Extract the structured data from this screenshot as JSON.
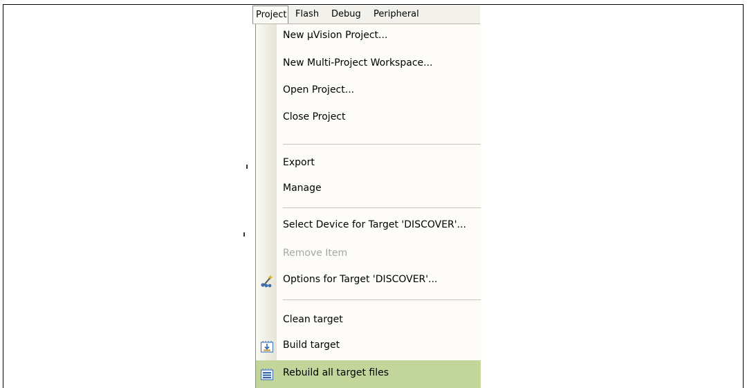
{
  "menubar": {
    "items": [
      "Project",
      "Flash",
      "Debug",
      "Peripheral"
    ]
  },
  "menu": {
    "items": [
      {
        "label": "New µVision Project...",
        "name": "menu-item-new-uvision-project",
        "disabled": false
      },
      {
        "label": "New Multi-Project Workspace...",
        "name": "menu-item-new-multi-project-workspace",
        "disabled": false
      },
      {
        "label": "Open Project...",
        "name": "menu-item-open-project",
        "disabled": false
      },
      {
        "label": "Close Project",
        "name": "menu-item-close-project",
        "disabled": false
      },
      {
        "label": "Export",
        "name": "menu-item-export",
        "disabled": false
      },
      {
        "label": "Manage",
        "name": "menu-item-manage",
        "disabled": false
      },
      {
        "label": "Select Device for Target 'DISCOVER'...",
        "name": "menu-item-select-device",
        "disabled": false
      },
      {
        "label": "Remove Item",
        "name": "menu-item-remove-item",
        "disabled": true
      },
      {
        "label": "Options for Target 'DISCOVER'...",
        "name": "menu-item-options-for-target",
        "disabled": false,
        "icon": "options-wand-icon"
      },
      {
        "label": "Clean target",
        "name": "menu-item-clean-target",
        "disabled": false
      },
      {
        "label": "Build target",
        "name": "menu-item-build-target",
        "disabled": false,
        "icon": "build-icon"
      },
      {
        "label": "Rebuild all target files",
        "name": "menu-item-rebuild-all",
        "disabled": false,
        "icon": "rebuild-icon",
        "highlighted": true
      }
    ]
  },
  "colors": {
    "highlight": "#c2d59b",
    "disabled_text": "#a6a6a6",
    "menu_bg": "#fdfcf9",
    "menubar_bg": "#f2f1ec"
  }
}
